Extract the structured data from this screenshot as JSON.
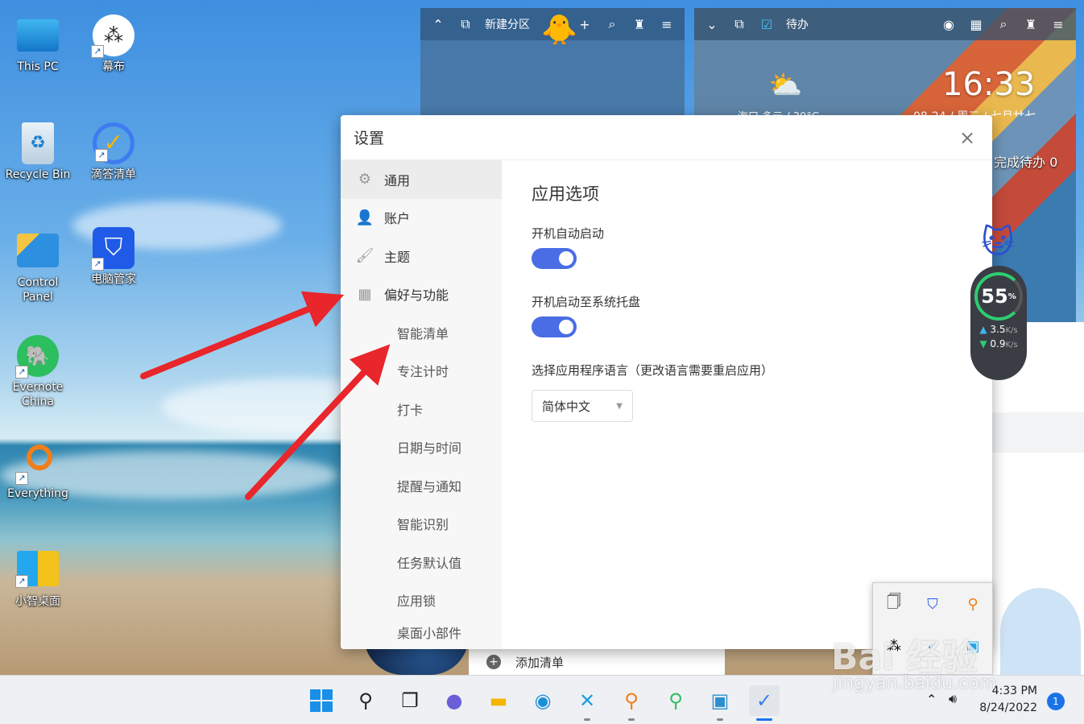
{
  "desktop": {
    "icons": [
      {
        "label": "This PC"
      },
      {
        "label": "幕布"
      },
      {
        "label": "Recycle Bin"
      },
      {
        "label": "滴答清单"
      },
      {
        "label": "Control Panel"
      },
      {
        "label": "电脑管家"
      },
      {
        "label": "Evernote China"
      },
      {
        "label": "Everything"
      },
      {
        "label": "小智桌面"
      }
    ]
  },
  "widget_left": {
    "title": "新建分区"
  },
  "widget_right": {
    "title": "待办",
    "time": "16:33",
    "date": "08-24 / 周三 / 七月廿七",
    "weather": "海口 多云 / 30°C",
    "todo_count": "完成待办 0"
  },
  "bottom_bar": {
    "add_list": "添加清单"
  },
  "settings": {
    "title": "设置",
    "close": "×",
    "sidebar": [
      {
        "label": "通用"
      },
      {
        "label": "账户"
      },
      {
        "label": "主题"
      },
      {
        "label": "偏好与功能"
      },
      {
        "label": "智能清单"
      },
      {
        "label": "专注计时"
      },
      {
        "label": "打卡"
      },
      {
        "label": "日期与时间"
      },
      {
        "label": "提醒与通知"
      },
      {
        "label": "智能识别"
      },
      {
        "label": "任务默认值"
      },
      {
        "label": "应用锁"
      },
      {
        "label": "桌面小部件"
      }
    ],
    "content": {
      "heading": "应用选项",
      "autostart_label": "开机自动启动",
      "autostart_on": true,
      "tray_label": "开机启动至系统托盘",
      "tray_on": true,
      "language_label": "选择应用程序语言（更改语言需要重启应用）",
      "language_value": "简体中文"
    }
  },
  "speed_widget": {
    "percent": "55",
    "unit": "%",
    "up": "3.5",
    "down": "0.9",
    "rate_unit": "K/s"
  },
  "taskbar": {
    "time": "4:33 PM",
    "date": "8/24/2022",
    "notifications": "1"
  },
  "watermark": {
    "line1": "Bai 经验",
    "line2": "jingyan.baidu.com"
  },
  "colors": {
    "accent": "#4a6de5",
    "arrow": "#e8262b",
    "taskbar_accent": "#1a73e8"
  }
}
